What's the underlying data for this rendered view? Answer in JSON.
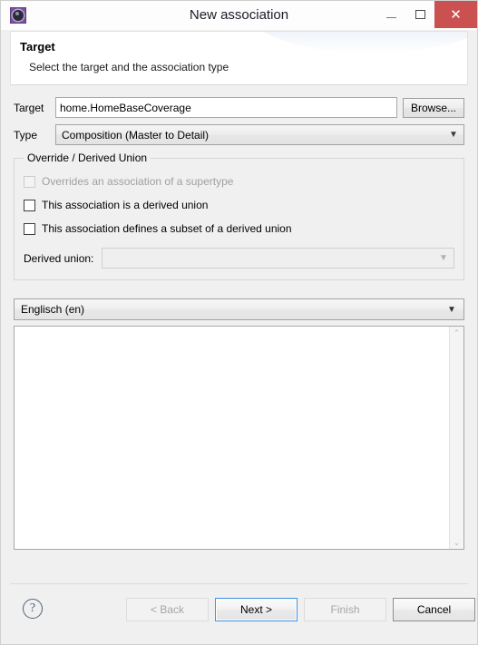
{
  "window": {
    "title": "New association",
    "icon": "gear-icon",
    "controls": {
      "minimize": "minimize-icon",
      "maximize": "maximize-icon",
      "close": "✕"
    }
  },
  "header": {
    "title": "Target",
    "subtitle": "Select the target and the association type"
  },
  "form": {
    "target": {
      "label": "Target",
      "value": "home.HomeBaseCoverage",
      "placeholder": "",
      "browse_label": "Browse..."
    },
    "type": {
      "label": "Type",
      "value": "Composition (Master to Detail)"
    }
  },
  "group": {
    "legend": "Override / Derived Union",
    "checkboxes": [
      {
        "label": "Overrides an association of a supertype",
        "checked": false,
        "enabled": false
      },
      {
        "label": "This association is a derived union",
        "checked": false,
        "enabled": true
      },
      {
        "label": "This association defines a subset of a derived union",
        "checked": false,
        "enabled": true
      }
    ],
    "derived_union": {
      "label": "Derived union:",
      "value": "",
      "enabled": false
    }
  },
  "description": {
    "language": "Englisch (en)",
    "text": "",
    "scrollbar": {
      "up": "⌃",
      "down": "⌄"
    }
  },
  "footer": {
    "help": "?",
    "buttons": [
      {
        "label": "< Back",
        "enabled": false,
        "focused": false
      },
      {
        "label": "Next >",
        "enabled": true,
        "focused": true
      },
      {
        "label": "Finish",
        "enabled": false,
        "focused": false
      },
      {
        "label": "Cancel",
        "enabled": true,
        "focused": false
      }
    ]
  },
  "colors": {
    "close_button": "#cb5050",
    "focus_ring": "#3f93e0",
    "app_icon": "#7c4fa3",
    "body": "#f0f0f0"
  }
}
